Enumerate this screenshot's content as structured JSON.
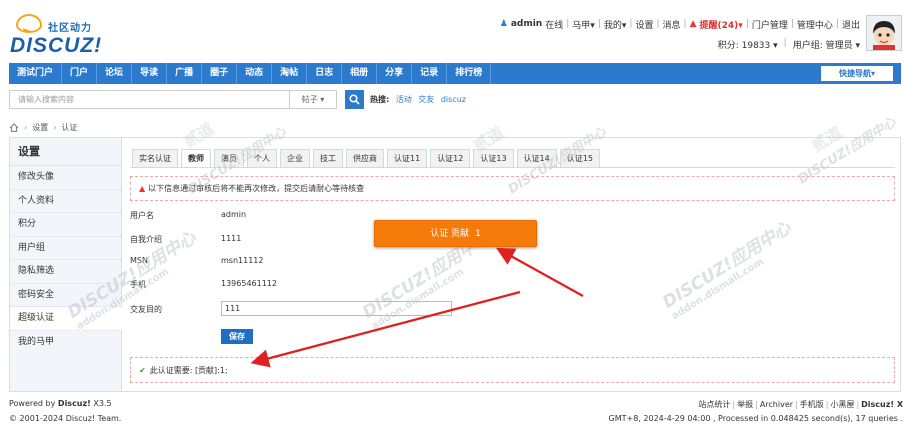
{
  "logo": {
    "cn": "社区动力",
    "en": "DISCUZ!"
  },
  "topbar": {
    "username": "admin",
    "status": "在线",
    "links": [
      "马甲",
      "我的",
      "设置",
      "消息"
    ],
    "remind": "提醒(24)",
    "links2": [
      "门户管理",
      "管理中心",
      "退出"
    ]
  },
  "userinfo": {
    "points": "积分: 19833",
    "group": "用户组: 管理员"
  },
  "nav": {
    "items": [
      "测试门户",
      "门户",
      "论坛",
      "导读",
      "广播",
      "圈子",
      "动态",
      "淘帖",
      "日志",
      "相册",
      "分享",
      "记录",
      "排行榜"
    ],
    "quick": "快捷导航"
  },
  "search": {
    "placeholder": "请输入搜索内容",
    "type": "帖子",
    "hot_label": "热搜:",
    "hot": [
      "活动",
      "交友",
      "discuz"
    ]
  },
  "breadcrumb": {
    "items": [
      "设置",
      "认证"
    ]
  },
  "sidebar": {
    "title": "设置",
    "items": [
      {
        "label": "修改头像"
      },
      {
        "label": "个人资料"
      },
      {
        "label": "积分"
      },
      {
        "label": "用户组"
      },
      {
        "label": "隐私筛选"
      },
      {
        "label": "密码安全"
      },
      {
        "label": "超级认证"
      },
      {
        "label": "我的马甲"
      }
    ]
  },
  "tabs": [
    "实名认证",
    "教师",
    "演员",
    "个人",
    "企业",
    "技工",
    "供应商",
    "认证11",
    "认证12",
    "认证13",
    "认证14",
    "认证15"
  ],
  "notice": "以下信息通过审核后将不能再次修改，提交后请耐心等待核查",
  "form": {
    "rows": [
      {
        "label": "用户名",
        "value": "admin"
      },
      {
        "label": "自我介绍",
        "value": "1111"
      },
      {
        "label": "MSN",
        "value": "msn11112"
      },
      {
        "label": "手机",
        "value": "13965461112"
      }
    ],
    "goal_label": "交友目的",
    "goal_value": "111",
    "save": "保存"
  },
  "orange_button": {
    "label": "认证 贡献",
    "count": "1"
  },
  "success": "此认证需要: [贡献]:1;",
  "footer": {
    "powered": "Powered by",
    "product": "Discuz!",
    "version": "X3.5",
    "copyright": "© 2001-2024 Discuz! Team.",
    "links": [
      "站点统计",
      "举报",
      "Archiver",
      "手机版",
      "小黑屋"
    ],
    "brand": "Discuz! X",
    "info": "GMT+8, 2024-4-29 04:00 , Processed in 0.048425 second(s), 17 queries ."
  },
  "watermark": {
    "brand": "DISCUZ!应用中心",
    "sub": "addon.dismall.com",
    "mark": "贰道"
  },
  "colors": {
    "nav": "#2b7acd",
    "orange": "#f47a0a",
    "arrow": "#e02020"
  }
}
